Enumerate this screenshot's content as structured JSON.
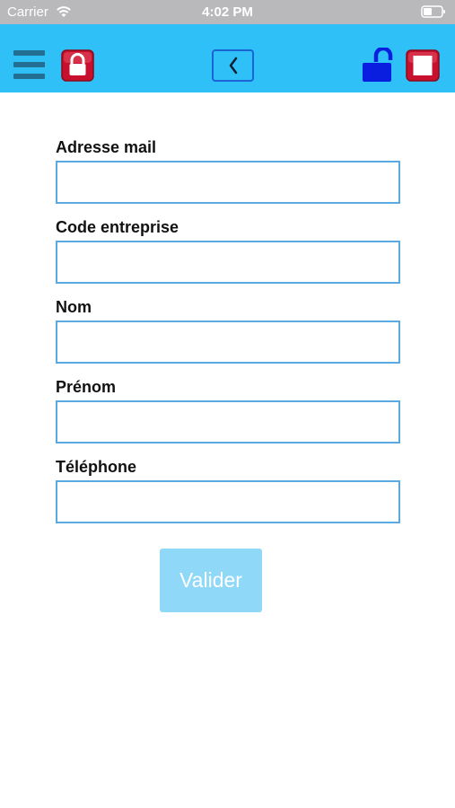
{
  "status_bar": {
    "carrier": "Carrier",
    "time": "4:02 PM"
  },
  "nav_bar": {
    "background_color": "#30c0f8",
    "menu_icon": "hamburger-menu-icon",
    "left_icon": "lock-red-icon",
    "center_icon": "chevron-left-icon",
    "right_icons": [
      "unlock-icon",
      "stop-icon"
    ]
  },
  "form": {
    "fields": [
      {
        "label": "Adresse mail",
        "value": "",
        "placeholder": ""
      },
      {
        "label": "Code entreprise",
        "value": "",
        "placeholder": ""
      },
      {
        "label": "Nom",
        "value": "",
        "placeholder": ""
      },
      {
        "label": "Prénom",
        "value": "",
        "placeholder": ""
      },
      {
        "label": "Téléphone",
        "value": "",
        "placeholder": ""
      }
    ],
    "submit_label": "Valider"
  }
}
